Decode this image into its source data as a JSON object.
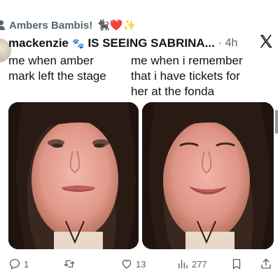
{
  "community": {
    "name": "Ambers Bambis!",
    "emojis": "🐈‍⬛❤️✨"
  },
  "tweet": {
    "display_name": "mackenzie",
    "name_emoji": "🐾",
    "name_rest": "IS SEEING SABRINA...",
    "time": "· 4h",
    "caption_left": "me when amber\nmark left the stage",
    "caption_right": "me when i remember\nthat i have tickets for\nher at the fonda"
  },
  "media": [
    {
      "icon": "photo-crying-girl-1"
    },
    {
      "icon": "photo-crying-girl-2"
    }
  ],
  "actions": {
    "replies": "1",
    "reposts": "",
    "likes": "13",
    "views": "277"
  },
  "colors": {
    "text": "#0f1419",
    "muted": "#536471",
    "background": "#ffffff"
  }
}
